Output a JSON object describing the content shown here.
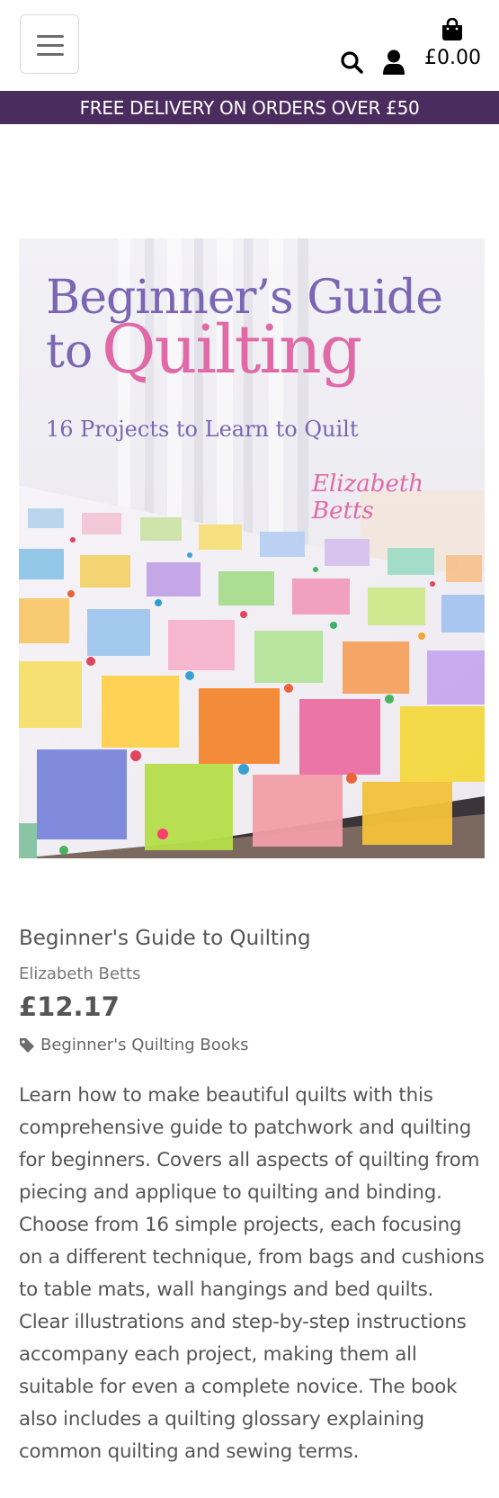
{
  "header": {
    "menu_icon": "hamburger-menu-icon",
    "search_icon": "search-icon",
    "account_icon": "user-icon",
    "bag_icon": "shopping-bag-icon",
    "cart_total": "£0.00"
  },
  "banner": {
    "text": "FREE DELIVERY ON ORDERS OVER £50",
    "background": "#4b2c5e"
  },
  "cover": {
    "title_line1": "Beginner’s Guide",
    "title_to": "to",
    "title_quilting": "Quilting",
    "subtitle": "16 Projects to Learn to Quilt",
    "author": "Elizabeth Betts",
    "title_color": "#7a66b3",
    "accent_color": "#e06aa8"
  },
  "product": {
    "name": "Beginner's Guide to Quilting",
    "author": "Elizabeth Betts",
    "price": "£12.17",
    "category_icon": "tag-icon",
    "category": "Beginner's Quilting Books",
    "description": "Learn how to make beautiful quilts with this comprehensive guide to patchwork and quilting for beginners. Covers all aspects of quilting from piecing and applique to quilting and binding. Choose from 16 simple projects, each focusing on a different technique, from bags and cushions to table mats, wall hangings and bed quilts. Clear illustrations and step-by-step instructions accompany each project, making them all suitable for even a complete novice. The book also includes a quilting glossary explaining common quilting and sewing terms."
  }
}
